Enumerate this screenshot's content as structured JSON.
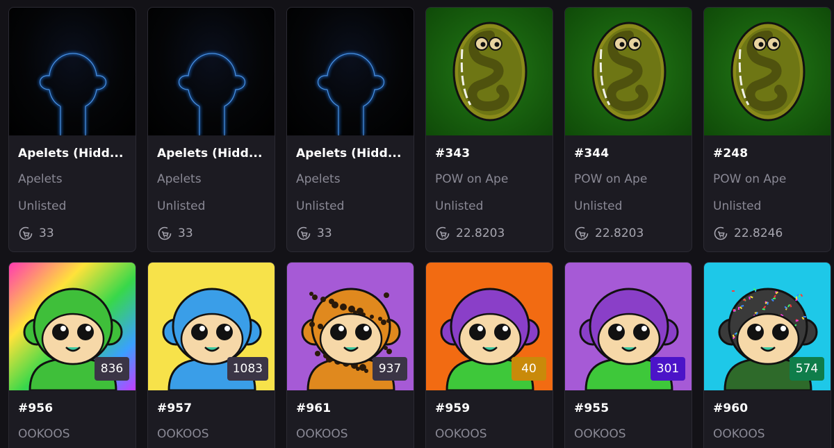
{
  "cards_top": [
    {
      "title": "Apelets (Hidd...",
      "collection": "Apelets",
      "status": "Unlisted",
      "price": "33",
      "art": "hidden-ape"
    },
    {
      "title": "Apelets (Hidd...",
      "collection": "Apelets",
      "status": "Unlisted",
      "price": "33",
      "art": "hidden-ape"
    },
    {
      "title": "Apelets (Hidd...",
      "collection": "Apelets",
      "status": "Unlisted",
      "price": "33",
      "art": "hidden-ape"
    },
    {
      "title": "#343",
      "collection": "POW on Ape",
      "status": "Unlisted",
      "price": "22.8203",
      "art": "pow-egg"
    },
    {
      "title": "#344",
      "collection": "POW on Ape",
      "status": "Unlisted",
      "price": "22.8203",
      "art": "pow-egg"
    },
    {
      "title": "#248",
      "collection": "POW on Ape",
      "status": "Unlisted",
      "price": "22.8246",
      "art": "pow-egg"
    }
  ],
  "cards_bottom": [
    {
      "title": "#956",
      "collection": "OOKOOS",
      "rank": "836",
      "rank_color": "#3b3546",
      "bg": "rainbow",
      "fur": "#3fbf3a"
    },
    {
      "title": "#957",
      "collection": "OOKOOS",
      "rank": "1083",
      "rank_color": "#3b3546",
      "bg": "#f7e24a",
      "fur": "#3a9ee8"
    },
    {
      "title": "#961",
      "collection": "OOKOOS",
      "rank": "937",
      "rank_color": "#3b3546",
      "bg": "#a65ad6",
      "fur": "leopard"
    },
    {
      "title": "#959",
      "collection": "OOKOOS",
      "rank": "40",
      "rank_color": "#c98a0a",
      "bg": "#f26b12",
      "fur": "#8a3fc8"
    },
    {
      "title": "#955",
      "collection": "OOKOOS",
      "rank": "301",
      "rank_color": "#4b14c8",
      "bg": "#a65ad6",
      "fur": "#8a3fc8"
    },
    {
      "title": "#960",
      "collection": "OOKOOS",
      "rank": "574",
      "rank_color": "#0f7d4a",
      "bg": "#1ec8e8",
      "fur": "confetti"
    }
  ],
  "icons": {
    "price": "cart-swap-icon"
  }
}
